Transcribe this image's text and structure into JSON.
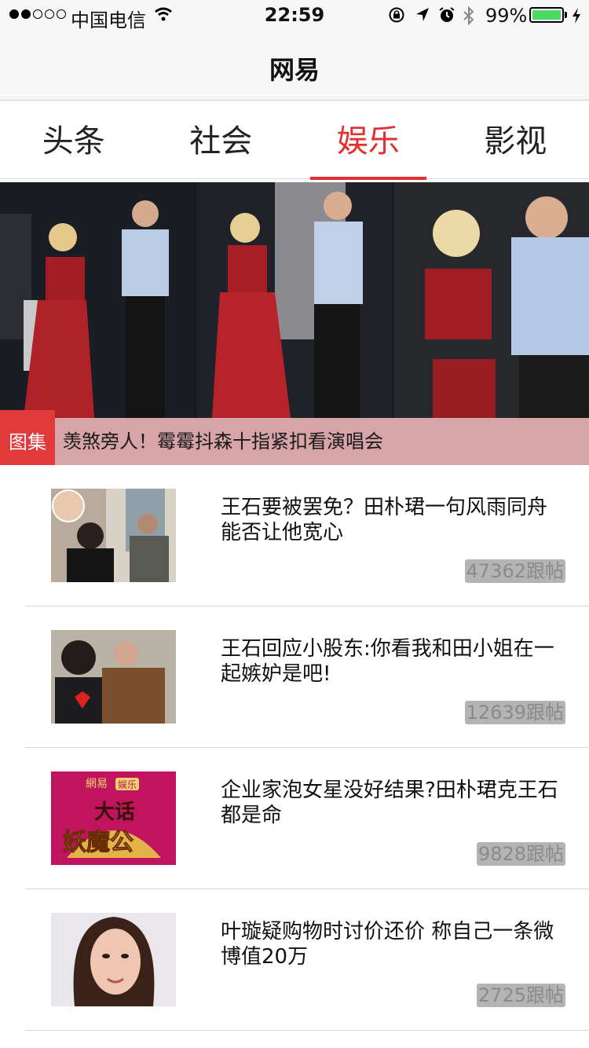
{
  "status_bar": {
    "carrier": "中国电信",
    "time": "22:59",
    "battery": "99%",
    "battery_level": 0.99,
    "icons": [
      "signal-dots-icon",
      "wifi-icon",
      "rotation-lock-icon",
      "location-arrow-icon",
      "alarm-icon",
      "bluetooth-icon",
      "battery-icon",
      "charging-icon"
    ]
  },
  "navbar": {
    "title": "网易"
  },
  "tabs": [
    {
      "label": "头条",
      "active": false
    },
    {
      "label": "社会",
      "active": false
    },
    {
      "label": "娱乐",
      "active": true
    },
    {
      "label": "影视",
      "active": false
    }
  ],
  "banner": {
    "tag": "图集",
    "caption": "羡煞旁人！霉霉抖森十指紧扣看演唱会"
  },
  "news": [
    {
      "title": "王石要被罢免？田朴珺一句风雨同舟能否让他宽心",
      "replies": "47362跟帖"
    },
    {
      "title": "王石回应小股东:你看我和田小姐在一起嫉妒是吧!",
      "replies": "12639跟帖"
    },
    {
      "title": "企业家泡女星没好结果?田朴珺克王石都是命",
      "replies": "9828跟帖"
    },
    {
      "title": "叶璇疑购物时讨价还价 称自己一条微博值20万",
      "replies": "2725跟帖"
    }
  ],
  "thumb4_logo": {
    "brand": "網易",
    "badge": "娱乐",
    "title_line1": "大话",
    "title_line2": "妖魔公"
  },
  "colors": {
    "accent": "#e42f2f",
    "nav_bg": "#f7f7f7",
    "caption_bg": "#d7a4a7",
    "count_bg": "#b4b4b4"
  }
}
